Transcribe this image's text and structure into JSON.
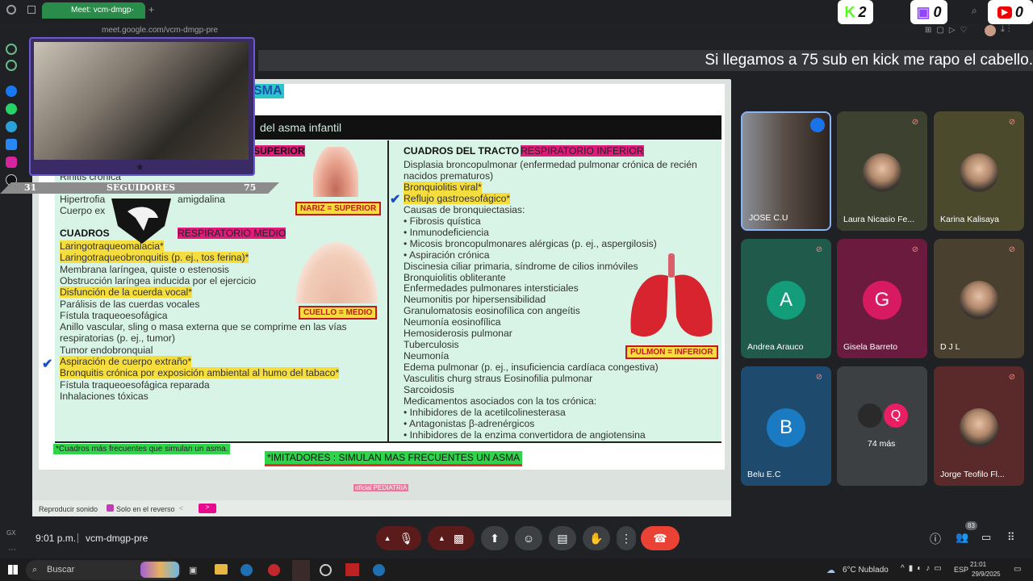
{
  "browser": {
    "tab_title": "Meet: vcm-dmgp-",
    "url": "meet.google.com/vcm-dmgp-pre"
  },
  "stream": {
    "kick_count": "2",
    "twitch_count": "0",
    "youtube_count": "0",
    "banner": "Si llegamos a 75 sub en kick me rapo el cabello.",
    "followers_label": "SEGUIDORES",
    "followers_current": "31",
    "followers_goal": "75"
  },
  "slide": {
    "title_fragment": "SMA",
    "subtitle": "del asma infantil",
    "left_lines": [
      {
        "t": "SUPERIOR",
        "c": "pk"
      },
      {
        "t": "Rinitis crónica",
        "c": ""
      },
      {
        "t": "Hipertrofia",
        "c": ""
      },
      {
        "t": "amigdalina",
        "c": ""
      },
      {
        "t": "Cuerpo ex",
        "c": ""
      }
    ],
    "medio_header": "CUADROS",
    "medio_pink": "RESPIRATORIO MEDIO",
    "medio_lines": [
      {
        "t": "Laringotraqueomalacia*",
        "c": "hl"
      },
      {
        "t": "Laringotraqueobronquitis (p. ej., tos ferina)*",
        "c": "hl"
      },
      {
        "t": "Membrana laríngea, quiste o estenosis",
        "c": ""
      },
      {
        "t": "Obstrucción laríngea inducida por el ejercicio",
        "c": ""
      },
      {
        "t": "Disfunción de la cuerda vocal*",
        "c": "hl"
      },
      {
        "t": "Parálisis de las cuerdas vocales",
        "c": ""
      },
      {
        "t": "Fístula traqueoesofágica",
        "c": ""
      },
      {
        "t": "Anillo vascular, sling o masa externa que se comprime en las vías",
        "c": ""
      },
      {
        "t": "   respiratorias (p. ej., tumor)",
        "c": ""
      },
      {
        "t": "Tumor endobronquial",
        "c": ""
      },
      {
        "t": "Aspiración de cuerpo extraño*",
        "c": "hl"
      },
      {
        "t": "Bronquitis crónica por exposición ambiental al humo del tabaco*",
        "c": "hl"
      },
      {
        "t": "Fístula traqueoesofágica reparada",
        "c": ""
      },
      {
        "t": "Inhalaciones tóxicas",
        "c": ""
      }
    ],
    "nariz_label": "NARIZ = SUPERIOR",
    "cuello_label": "CUELLO = MEDIO",
    "pulmon_label": "PULMON = INFERIOR",
    "right_header": "CUADROS DEL TRACTO",
    "right_pink": "RESPIRATORIO INFERIOR",
    "right_lines": [
      {
        "t": "Displasia broncopulmonar (enfermedad pulmonar crónica de recién",
        "c": ""
      },
      {
        "t": "   nacidos prematuros)",
        "c": ""
      },
      {
        "t": "Bronquiolitis viral*",
        "c": "hl"
      },
      {
        "t": "Reflujo gastroesofágico*",
        "c": "hl"
      },
      {
        "t": "Causas de bronquiectasias:",
        "c": ""
      },
      {
        "t": "•  Fibrosis quística",
        "c": ""
      },
      {
        "t": "•  Inmunodeficiencia",
        "c": ""
      },
      {
        "t": "•  Micosis broncopulmonares alérgicas (p. ej., aspergilosis)",
        "c": ""
      },
      {
        "t": "•  Aspiración crónica",
        "c": ""
      },
      {
        "t": "Discinesia ciliar primaria, síndrome de cilios inmóviles",
        "c": ""
      },
      {
        "t": "Bronquiolitis obliterante",
        "c": ""
      },
      {
        "t": "Enfermedades pulmonares intersticiales",
        "c": ""
      },
      {
        "t": "Neumonitis por hipersensibilidad",
        "c": ""
      },
      {
        "t": "Granulomatosis eosinofílica con angeítis",
        "c": ""
      },
      {
        "t": "Neumonía eosinofílica",
        "c": ""
      },
      {
        "t": "Hemosiderosis pulmonar",
        "c": ""
      },
      {
        "t": "Tuberculosis",
        "c": ""
      },
      {
        "t": "Neumonía",
        "c": ""
      },
      {
        "t": "Edema pulmonar (p. ej., insuficiencia cardíaca congestiva)",
        "c": ""
      },
      {
        "t": "Vasculitis  churg straus  Eosinofilia pulmonar",
        "c": ""
      },
      {
        "t": "Sarcoidosis",
        "c": ""
      },
      {
        "t": "Medicamentos asociados con la tos crónica:",
        "c": ""
      },
      {
        "t": "•  Inhibidores de la acetilcolinesterasa",
        "c": ""
      },
      {
        "t": "•  Antagonistas β-adrenérgicos",
        "c": ""
      },
      {
        "t": "•  Inhibidores de la enzima convertidora de angiotensina",
        "c": ""
      }
    ],
    "footnote": "*Cuadros más frecuentes que simulan un asma.",
    "banner_green": "*IMITADORES : SIMULAN MAS FRECUENTES UN ASMA",
    "watermark": "oficial PEDIATRIA",
    "bar_play": "Reproducir sonido",
    "bar_check": "Solo en el reverso"
  },
  "participants": [
    {
      "name": "JOSE C.U",
      "type": "video",
      "color": "#5a4a3e"
    },
    {
      "name": "Laura Nicasio Fe...",
      "type": "photo",
      "color": "#3d4230"
    },
    {
      "name": "Karina Kalisaya",
      "type": "photo",
      "color": "#4b4a2c"
    },
    {
      "name": "Andrea Arauco",
      "type": "letter",
      "letter": "A",
      "color": "#1f5a4a",
      "avatar": "#139d7a"
    },
    {
      "name": "Gisela Barreto",
      "type": "letter",
      "letter": "G",
      "color": "#6a1b3e",
      "avatar": "#d81b60"
    },
    {
      "name": "D J L",
      "type": "photo",
      "color": "#4a4030"
    },
    {
      "name": "Belu E.C",
      "type": "letter",
      "letter": "B",
      "color": "#1e4a6e",
      "avatar": "#1a7ac2"
    },
    {
      "name": "74 más",
      "type": "more",
      "color": "#3c4043"
    },
    {
      "name": "Jorge Teofilo Fl...",
      "type": "photo",
      "color": "#5a2a2a"
    }
  ],
  "meet": {
    "time": "9:01 p.m.",
    "code": "vcm-dmgp-pre",
    "people_count": "83"
  },
  "taskbar": {
    "search": "Buscar",
    "weather": "6°C  Nublado",
    "lang": "ESP",
    "clock": "21:01",
    "date": "29/9/2025"
  }
}
